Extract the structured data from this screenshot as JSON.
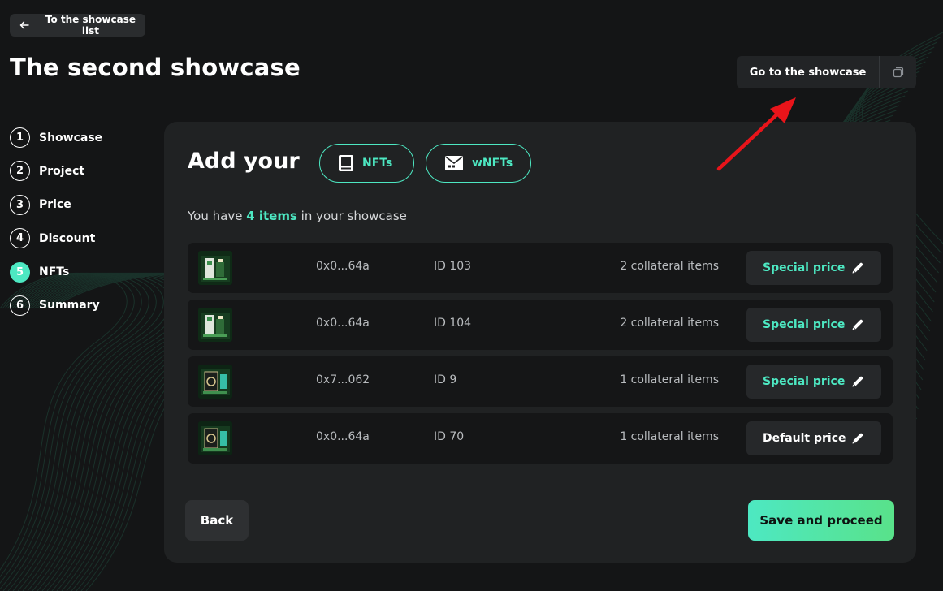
{
  "header": {
    "back_link_label": "To the showcase list",
    "page_title": "The second showcase",
    "goto_showcase_label": "Go to the showcase"
  },
  "steps": [
    {
      "num": "1",
      "label": "Showcase",
      "active": false
    },
    {
      "num": "2",
      "label": "Project",
      "active": false
    },
    {
      "num": "3",
      "label": "Price",
      "active": false
    },
    {
      "num": "4",
      "label": "Discount",
      "active": false
    },
    {
      "num": "5",
      "label": "NFTs",
      "active": true
    },
    {
      "num": "6",
      "label": "Summary",
      "active": false
    }
  ],
  "card": {
    "title": "Add your",
    "nfts_button": "NFTs",
    "wnfts_button": "wNFTs",
    "count_prefix": "You have ",
    "count_highlight": "4 items",
    "count_suffix": " in your showcase"
  },
  "items": [
    {
      "address": "0x0...64a",
      "id": "ID 103",
      "collateral": "2 collateral items",
      "price_label": "Special price",
      "price_type": "special",
      "thumb": "nft-thumbnail-a"
    },
    {
      "address": "0x0...64a",
      "id": "ID 104",
      "collateral": "2 collateral items",
      "price_label": "Special price",
      "price_type": "special",
      "thumb": "nft-thumbnail-a"
    },
    {
      "address": "0x7...062",
      "id": "ID 9",
      "collateral": "1 collateral items",
      "price_label": "Special price",
      "price_type": "special",
      "thumb": "nft-thumbnail-b"
    },
    {
      "address": "0x0...64a",
      "id": "ID 70",
      "collateral": "1 collateral items",
      "price_label": "Default price",
      "price_type": "default",
      "thumb": "nft-thumbnail-b"
    }
  ],
  "footer": {
    "back_label": "Back",
    "save_label": "Save and proceed"
  },
  "colors": {
    "accent": "#4de8c2",
    "background": "#141516",
    "card": "#202223",
    "annotation_arrow": "#e8141a"
  },
  "icons": [
    "arrow-left-icon",
    "copy-icon",
    "nft-card-icon",
    "wnft-envelope-icon",
    "pencil-icon"
  ]
}
